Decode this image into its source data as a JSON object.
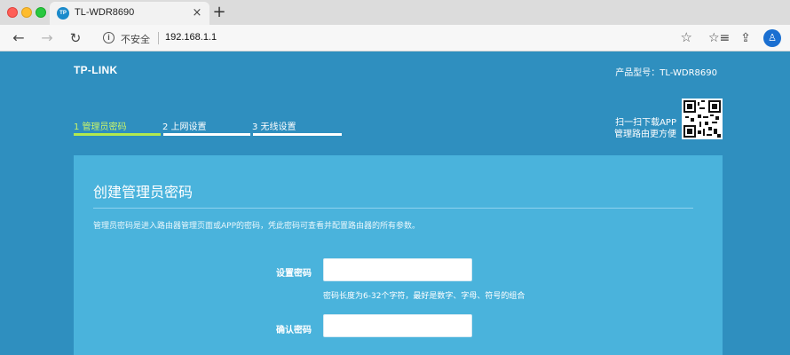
{
  "browser": {
    "tab_title": "TL-WDR8690",
    "tab_favicon_text": "TP",
    "tab_close": "×",
    "new_tab": "+",
    "back": "←",
    "forward": "→",
    "reload": "↻",
    "security_label": "不安全",
    "url": "192.168.1.1",
    "info_glyph": "i",
    "star": "☆",
    "favorites_glyph": "☆≡",
    "share_glyph": "⇪",
    "user_glyph": "♙"
  },
  "header": {
    "logo": "TP-LINK",
    "model": "产品型号：TL-WDR8690"
  },
  "steps": [
    {
      "label": "1 管理员密码",
      "active": true
    },
    {
      "label": "2 上网设置",
      "active": false
    },
    {
      "label": "3 无线设置",
      "active": false
    }
  ],
  "qr": {
    "line1": "扫一扫下载APP",
    "line2": "管理路由更方便"
  },
  "panel": {
    "title": "创建管理员密码",
    "description": "管理员密码是进入路由器管理页面或APP的密码，凭此密码可查看并配置路由器的所有参数。",
    "password_label": "设置密码",
    "password_value": "",
    "hint": "密码长度为6-32个字符，最好是数字、字母、符号的组合",
    "confirm_label": "确认密码",
    "confirm_value": ""
  },
  "colors": {
    "page_bg": "#2f8fbf",
    "panel_bg": "#4ab3dc",
    "active_step": "#b3ea4e"
  }
}
